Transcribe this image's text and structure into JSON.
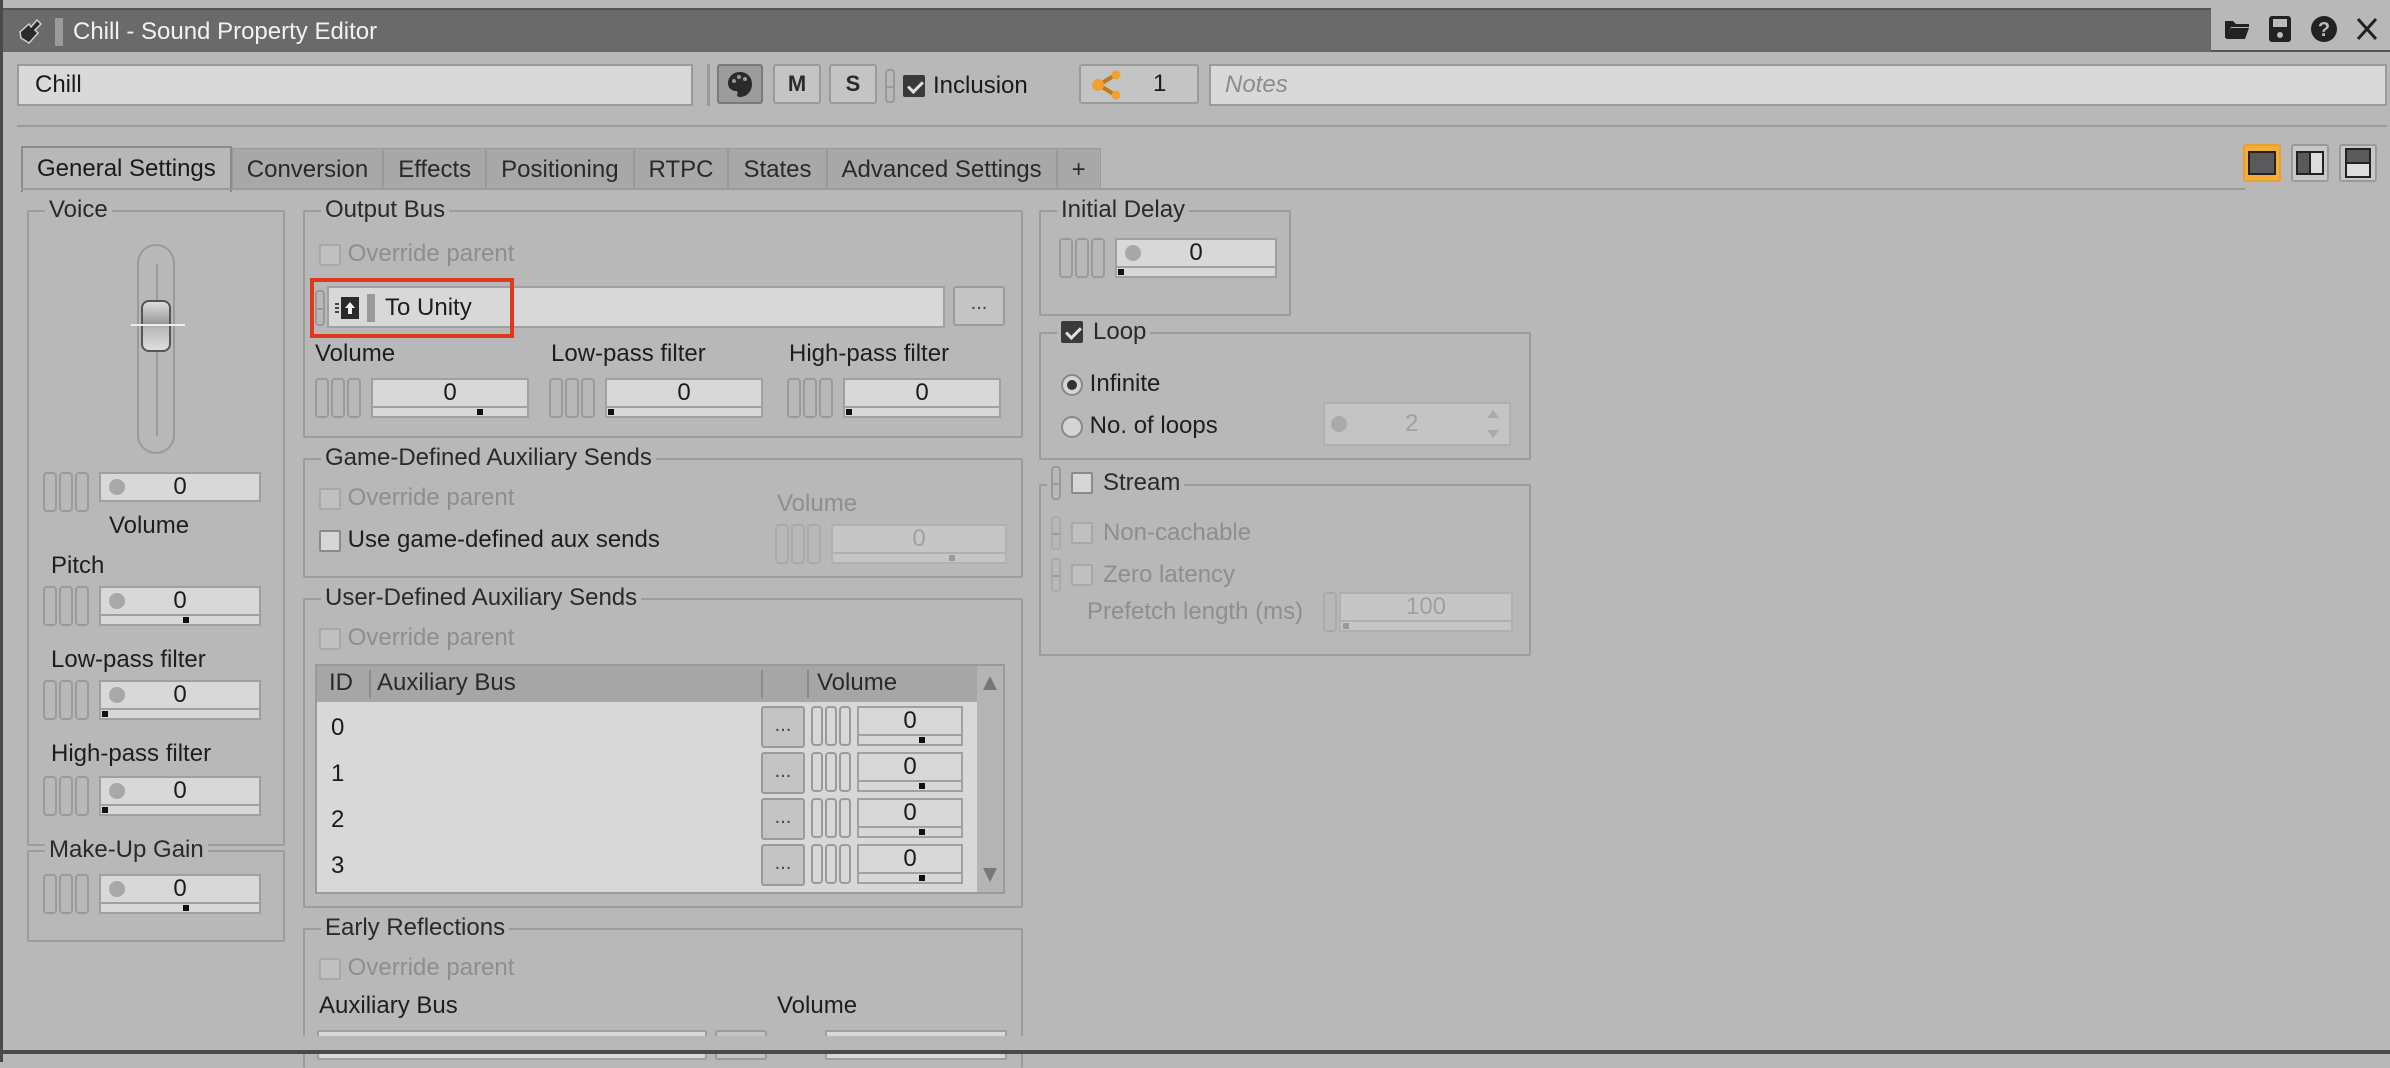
{
  "window": {
    "title": "Chill - Sound Property Editor",
    "title_icons": [
      "open-folder-icon",
      "save-icon",
      "help-icon",
      "close-icon"
    ],
    "close_label": "X"
  },
  "toolbar": {
    "name_value": "Chill",
    "color_button": "palette-icon",
    "mute_label": "M",
    "solo_label": "S",
    "inclusion_label": "Inclusion",
    "inclusion_checked": true,
    "share_count": "1",
    "notes_placeholder": "Notes",
    "accent_color": "#f5ad35"
  },
  "tabs": [
    {
      "label": "General Settings",
      "active": true
    },
    {
      "label": "Conversion"
    },
    {
      "label": "Effects"
    },
    {
      "label": "Positioning"
    },
    {
      "label": "RTPC"
    },
    {
      "label": "States"
    },
    {
      "label": "Advanced Settings"
    },
    {
      "label": "+"
    }
  ],
  "layout_buttons": [
    "single-pane",
    "split-vertical",
    "split-horizontal"
  ],
  "voice": {
    "title": "Voice",
    "volume": {
      "label": "Volume",
      "value": "0",
      "fader_level": 0.5
    },
    "pitch": {
      "label": "Pitch",
      "value": "0",
      "slider_pos": 0.5
    },
    "lowpass": {
      "label": "Low-pass filter",
      "value": "0",
      "slider_pos": 0
    },
    "highpass": {
      "label": "High-pass filter",
      "value": "0",
      "slider_pos": 0
    }
  },
  "makeup": {
    "title": "Make-Up Gain",
    "value": "0",
    "slider_pos": 0.5
  },
  "output_bus": {
    "title": "Output Bus",
    "override_label": "Override parent",
    "bus_name": "To Unity",
    "browse_label": "...",
    "volume": {
      "label": "Volume",
      "value": "0",
      "slider_pos": 0.6
    },
    "lowpass": {
      "label": "Low-pass filter",
      "value": "0",
      "slider_pos": 0
    },
    "highpass": {
      "label": "High-pass filter",
      "value": "0",
      "slider_pos": 0
    }
  },
  "game_aux": {
    "title": "Game-Defined Auxiliary Sends",
    "override_label": "Override parent",
    "use_label": "Use game-defined aux sends",
    "volume_label": "Volume",
    "volume_value": "0",
    "slider_pos": 0.65
  },
  "user_aux": {
    "title": "User-Defined Auxiliary Sends",
    "override_label": "Override parent",
    "columns": [
      "ID",
      "Auxiliary Bus",
      "",
      "Volume"
    ],
    "rows": [
      {
        "id": "0",
        "bus": "",
        "browse": "...",
        "volume": "0"
      },
      {
        "id": "1",
        "bus": "",
        "browse": "...",
        "volume": "0"
      },
      {
        "id": "2",
        "bus": "",
        "browse": "...",
        "volume": "0"
      },
      {
        "id": "3",
        "bus": "",
        "browse": "...",
        "volume": "0"
      }
    ]
  },
  "early_reflections": {
    "title": "Early Reflections",
    "override_label": "Override parent",
    "aux_bus_label": "Auxiliary Bus",
    "volume_label": "Volume"
  },
  "initial_delay": {
    "title": "Initial Delay",
    "value": "0",
    "slider_pos": 0
  },
  "loop": {
    "title": "Loop",
    "checked": true,
    "infinite_label": "Infinite",
    "infinite_selected": true,
    "count_label": "No. of loops",
    "count_value": "2"
  },
  "stream": {
    "title": "Stream",
    "checked": false,
    "noncachable_label": "Non-cachable",
    "zerolatency_label": "Zero latency",
    "prefetch_label": "Prefetch length (ms)",
    "prefetch_value": "100"
  }
}
